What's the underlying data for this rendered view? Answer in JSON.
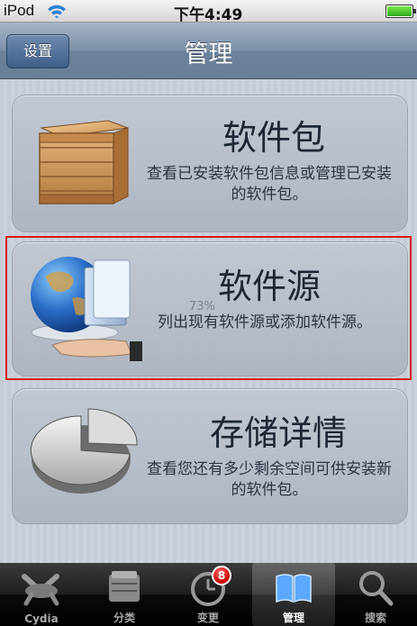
{
  "status_bar": {
    "carrier": "iPod",
    "time": "下午4:49"
  },
  "nav": {
    "back_label": "设置",
    "title": "管理"
  },
  "cards": [
    {
      "title": "软件包",
      "desc": "查看已安装软件包信息或管理已安装的软件包。"
    },
    {
      "title": "软件源",
      "desc": "列出现有软件源或添加软件源。",
      "overlay": "73%"
    },
    {
      "title": "存储详情",
      "desc": "查看您还有多少剩余空间可供安装新的软件包。"
    }
  ],
  "tabs": [
    {
      "label": "Cydia",
      "icon": "cydia-icon"
    },
    {
      "label": "分类",
      "icon": "sections-icon"
    },
    {
      "label": "变更",
      "icon": "clock-icon",
      "badge": "8"
    },
    {
      "label": "管理",
      "icon": "book-icon",
      "active": true
    },
    {
      "label": "搜索",
      "icon": "search-icon"
    }
  ]
}
